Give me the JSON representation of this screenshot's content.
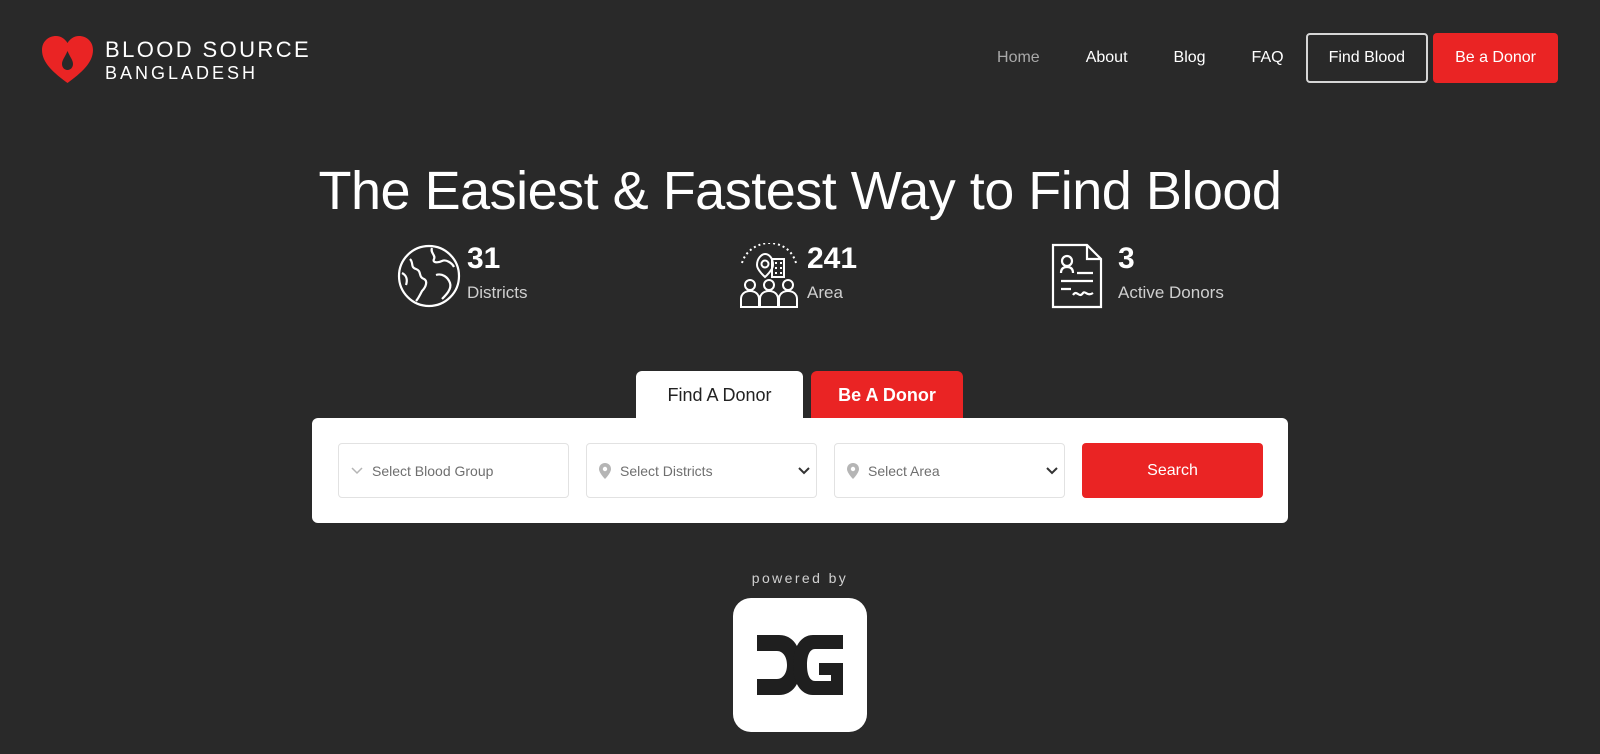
{
  "brand": {
    "name_line1": "BLOOD SOURCE",
    "name_line2": "BANGLADESH",
    "logo_icon": "heart-drop-icon",
    "color": "#ea2424"
  },
  "nav": {
    "items": [
      {
        "label": "Home",
        "active": true
      },
      {
        "label": "About"
      },
      {
        "label": "Blog"
      },
      {
        "label": "FAQ"
      }
    ],
    "find_blood_label": "Find Blood",
    "be_donor_label": "Be a Donor"
  },
  "hero": {
    "title": "The Easiest & Fastest Way to Find Blood"
  },
  "stats": [
    {
      "value": "31",
      "label": "Districts",
      "icon": "globe-icon"
    },
    {
      "value": "241",
      "label": "Area",
      "icon": "area-people-icon"
    },
    {
      "value": "3",
      "label": "Active Donors",
      "icon": "document-certificate-icon"
    }
  ],
  "search": {
    "tabs": [
      {
        "label": "Find A Donor",
        "active": true
      },
      {
        "label": "Be A Donor",
        "active": false
      }
    ],
    "blood_group_placeholder": "Select Blood Group",
    "districts_placeholder": "Select Districts",
    "area_placeholder": "Select Area",
    "search_label": "Search"
  },
  "footer": {
    "powered_by": "powered by",
    "partner_logo": "DG"
  },
  "colors": {
    "background": "#292929",
    "accent": "#ea2424",
    "card": "#ffffff"
  }
}
